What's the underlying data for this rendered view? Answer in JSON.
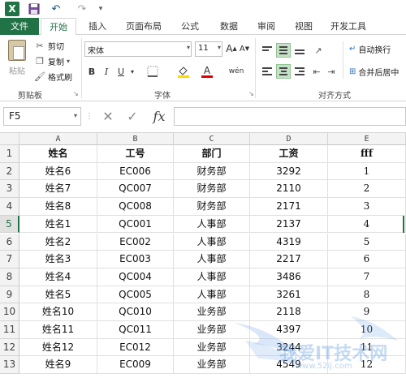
{
  "quick_access": {
    "app_logo": "X",
    "undo": "↶",
    "redo": "↷"
  },
  "tabs": [
    {
      "label": "文件"
    },
    {
      "label": "开始"
    },
    {
      "label": "插入"
    },
    {
      "label": "页面布局"
    },
    {
      "label": "公式"
    },
    {
      "label": "数据"
    },
    {
      "label": "审阅"
    },
    {
      "label": "视图"
    },
    {
      "label": "开发工具"
    }
  ],
  "clipboard": {
    "paste": "粘贴",
    "cut": "剪切",
    "copy": "复制",
    "format_painter": "格式刷",
    "group_label": "剪贴板"
  },
  "font": {
    "name": "宋体",
    "size": "11",
    "bold": "B",
    "italic": "I",
    "underline": "U",
    "grow": "A",
    "shrink": "A",
    "font_color_letter": "A",
    "phonetic": "wén",
    "group_label": "字体"
  },
  "alignment": {
    "wrap_text": "自动换行",
    "merge_center": "合并后居中",
    "group_label": "对齐方式"
  },
  "formula_bar": {
    "cell_ref": "F5",
    "cancel": "✕",
    "confirm": "✓",
    "fx": "fx",
    "value": ""
  },
  "columns": [
    "A",
    "B",
    "C",
    "D",
    "E"
  ],
  "rows": [
    {
      "num": "1",
      "cells": [
        "姓名",
        "工号",
        "部门",
        "工资",
        "fff"
      ]
    },
    {
      "num": "2",
      "cells": [
        "姓名6",
        "EC006",
        "财务部",
        "3292",
        "1"
      ]
    },
    {
      "num": "3",
      "cells": [
        "姓名7",
        "QC007",
        "财务部",
        "2110",
        "2"
      ]
    },
    {
      "num": "4",
      "cells": [
        "姓名8",
        "QC008",
        "财务部",
        "2171",
        "3"
      ]
    },
    {
      "num": "5",
      "cells": [
        "姓名1",
        "QC001",
        "人事部",
        "2137",
        "4"
      ]
    },
    {
      "num": "6",
      "cells": [
        "姓名2",
        "EC002",
        "人事部",
        "4319",
        "5"
      ]
    },
    {
      "num": "7",
      "cells": [
        "姓名3",
        "EC003",
        "人事部",
        "2217",
        "6"
      ]
    },
    {
      "num": "8",
      "cells": [
        "姓名4",
        "QC004",
        "人事部",
        "3486",
        "7"
      ]
    },
    {
      "num": "9",
      "cells": [
        "姓名5",
        "QC005",
        "人事部",
        "3261",
        "8"
      ]
    },
    {
      "num": "10",
      "cells": [
        "姓名10",
        "QC010",
        "业务部",
        "2118",
        "9"
      ]
    },
    {
      "num": "11",
      "cells": [
        "姓名11",
        "QC011",
        "业务部",
        "4397",
        "10"
      ]
    },
    {
      "num": "12",
      "cells": [
        "姓名12",
        "EC012",
        "业务部",
        "3244",
        "11"
      ]
    },
    {
      "num": "13",
      "cells": [
        "姓名9",
        "EC009",
        "业务部",
        "4549",
        "12"
      ]
    }
  ],
  "selected_row": "5",
  "watermark": {
    "text": "我爱IT技术网",
    "url": "www.52ij.com"
  },
  "colors": {
    "accent": "#217346",
    "selection_fill": "#c5e0c6"
  }
}
